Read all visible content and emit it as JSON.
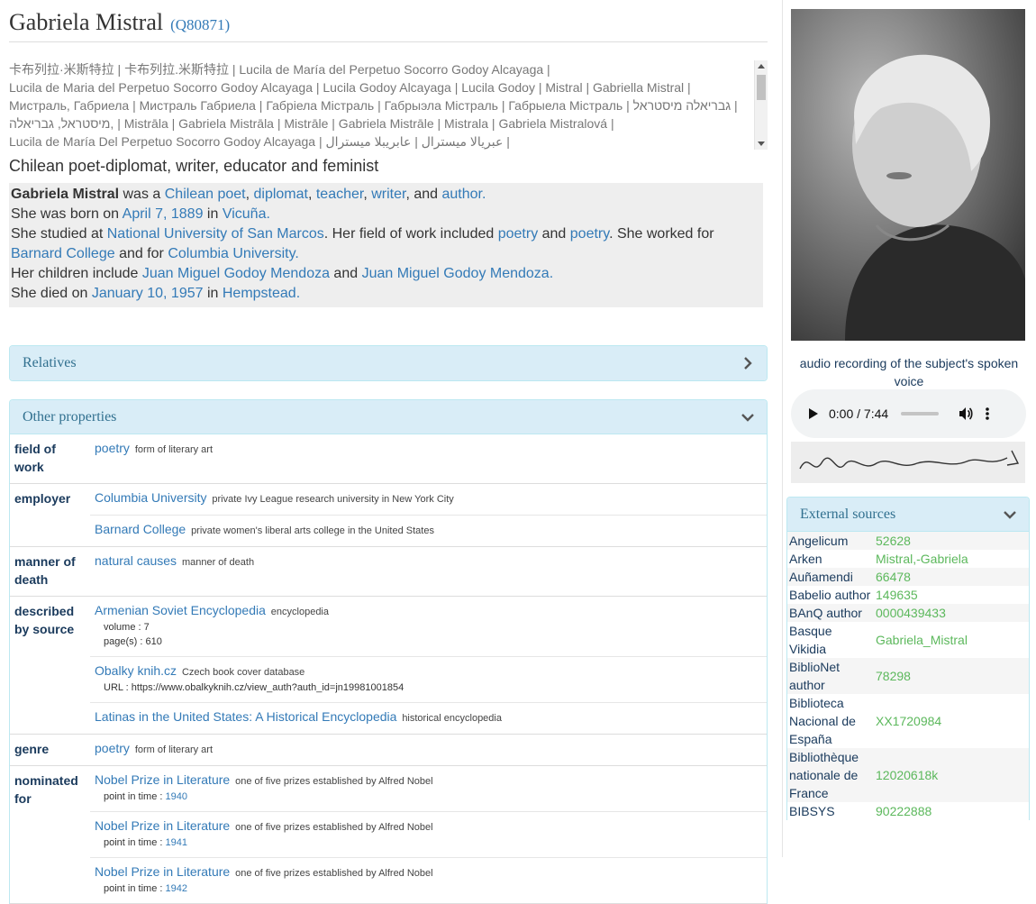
{
  "header": {
    "name": "Gabriela Mistral",
    "qid": "(Q80871)"
  },
  "aliases": [
    "卡布列拉·米斯特拉 | 卡布列拉.米斯特拉 | Lucila de María del Perpetuo Socorro Godoy Alcayaga |",
    "Lucila de Maria del Perpetuo Socorro Godoy Alcayaga | Lucila Godoy Alcayaga | Lucila Godoy | Mistral | Gabriella Mistral |",
    "Мистраль, Габриела | Мистраль Габриела | Габрiела Мiстраль | Габрыэла Мiстраль | Габрыела Мiстраль | גבריאלה מיסטראל |",
    "מיסטראל, גבריאלה, | Mistrāla | Gabriela Mistrāla | Mistrāle | Gabriela Mistrāle | Mistrala | Gabriela Mistralová |",
    "Lucila de María Del Perpetuo Socorro Godoy Alcayaga | عبريالا ميسترال | عابريبلا ميسترال |"
  ],
  "description": "Chilean poet-diplomat, writer, educator and feminist",
  "summary": {
    "s1": {
      "name": "Gabriela Mistral",
      "was": " was a ",
      "l1": "Chilean",
      "l2": "poet",
      "c1": ", ",
      "l3": "diplomat",
      "c2": ", ",
      "l4": "teacher",
      "c3": ", ",
      "l5": "writer",
      "c4": ", and ",
      "l6": "author",
      "end": "."
    },
    "s2": {
      "t1": "She was born on ",
      "l1": "April 7, 1889",
      "t2": " in ",
      "l2": "Vicuña",
      "end": "."
    },
    "s3": {
      "t1": "She studied at ",
      "l1": "National University of San Marcos",
      "t2": ". Her field of work included ",
      "l2": "poetry",
      "t3": " and ",
      "l3": "poetry",
      "t4": ". She worked for ",
      "l4": "Barnard College",
      "t5": " and for ",
      "l5": "Columbia University",
      "end": "."
    },
    "s4": {
      "t1": "Her children include ",
      "l1": "Juan Miguel Godoy Mendoza",
      "t2": " and ",
      "l2": "Juan Miguel Godoy Mendoza",
      "end": "."
    },
    "s5": {
      "t1": "She died on ",
      "l1": "January 10, 1957",
      "t2": " in ",
      "l2": "Hempstead",
      "end": "."
    }
  },
  "relatives": {
    "title": "Relatives"
  },
  "other": {
    "title": "Other properties",
    "props": [
      {
        "name": "field of work",
        "values": [
          {
            "label": "poetry",
            "desc": "form of literary art"
          }
        ]
      },
      {
        "name": "employer",
        "values": [
          {
            "label": "Columbia University",
            "desc": "private Ivy League research university in New York City"
          },
          {
            "label": "Barnard College",
            "desc": "private women's liberal arts college in the United States"
          }
        ]
      },
      {
        "name": "manner of death",
        "values": [
          {
            "label": "natural causes",
            "desc": "manner of death"
          }
        ]
      },
      {
        "name": "described by source",
        "values": [
          {
            "label": "Armenian Soviet Encyclopedia",
            "desc": "encyclopedia",
            "quals": [
              {
                "k": "volume",
                "v": "7"
              },
              {
                "k": "page(s)",
                "v": "610"
              }
            ]
          },
          {
            "label": "Obalky knih.cz",
            "desc": "Czech book cover database",
            "quals": [
              {
                "k": "URL",
                "v": "https://www.obalkyknih.cz/view_auth?auth_id=jn19981001854"
              }
            ]
          },
          {
            "label": "Latinas in the United States: A Historical Encyclopedia",
            "desc": "historical encyclopedia"
          }
        ]
      },
      {
        "name": "genre",
        "values": [
          {
            "label": "poetry",
            "desc": "form of literary art"
          }
        ]
      },
      {
        "name": "nominated for",
        "values": [
          {
            "label": "Nobel Prize in Literature",
            "desc": "one of five prizes established by Alfred Nobel",
            "quals": [
              {
                "k": "point in time",
                "v": "1940",
                "link": true
              }
            ]
          },
          {
            "label": "Nobel Prize in Literature",
            "desc": "one of five prizes established by Alfred Nobel",
            "quals": [
              {
                "k": "point in time",
                "v": "1941",
                "link": true
              }
            ]
          },
          {
            "label": "Nobel Prize in Literature",
            "desc": "one of five prizes established by Alfred Nobel",
            "quals": [
              {
                "k": "point in time",
                "v": "1942",
                "link": true
              }
            ]
          }
        ]
      }
    ]
  },
  "media": {
    "audio_caption": "audio recording of the subject's spoken voice",
    "audio_time": "0:00 / 7:44"
  },
  "external": {
    "title": "External sources",
    "rows": [
      {
        "name": "Angelicum",
        "value": "52628"
      },
      {
        "name": "Arken",
        "value": "Mistral,-Gabriela"
      },
      {
        "name": "Auñamendi",
        "value": "66478"
      },
      {
        "name": "Babelio author",
        "value": "149635"
      },
      {
        "name": "BAnQ author",
        "value": "0000439433"
      },
      {
        "name": "Basque Vikidia",
        "value": "Gabriela_Mistral"
      },
      {
        "name": "BiblioNet author",
        "value": "78298"
      },
      {
        "name": "Biblioteca Nacional de España",
        "value": "XX1720984"
      },
      {
        "name": "Bibliothèque nationale de France",
        "value": "12020618k"
      },
      {
        "name": "BIBSYS",
        "value": "90222888"
      }
    ]
  }
}
